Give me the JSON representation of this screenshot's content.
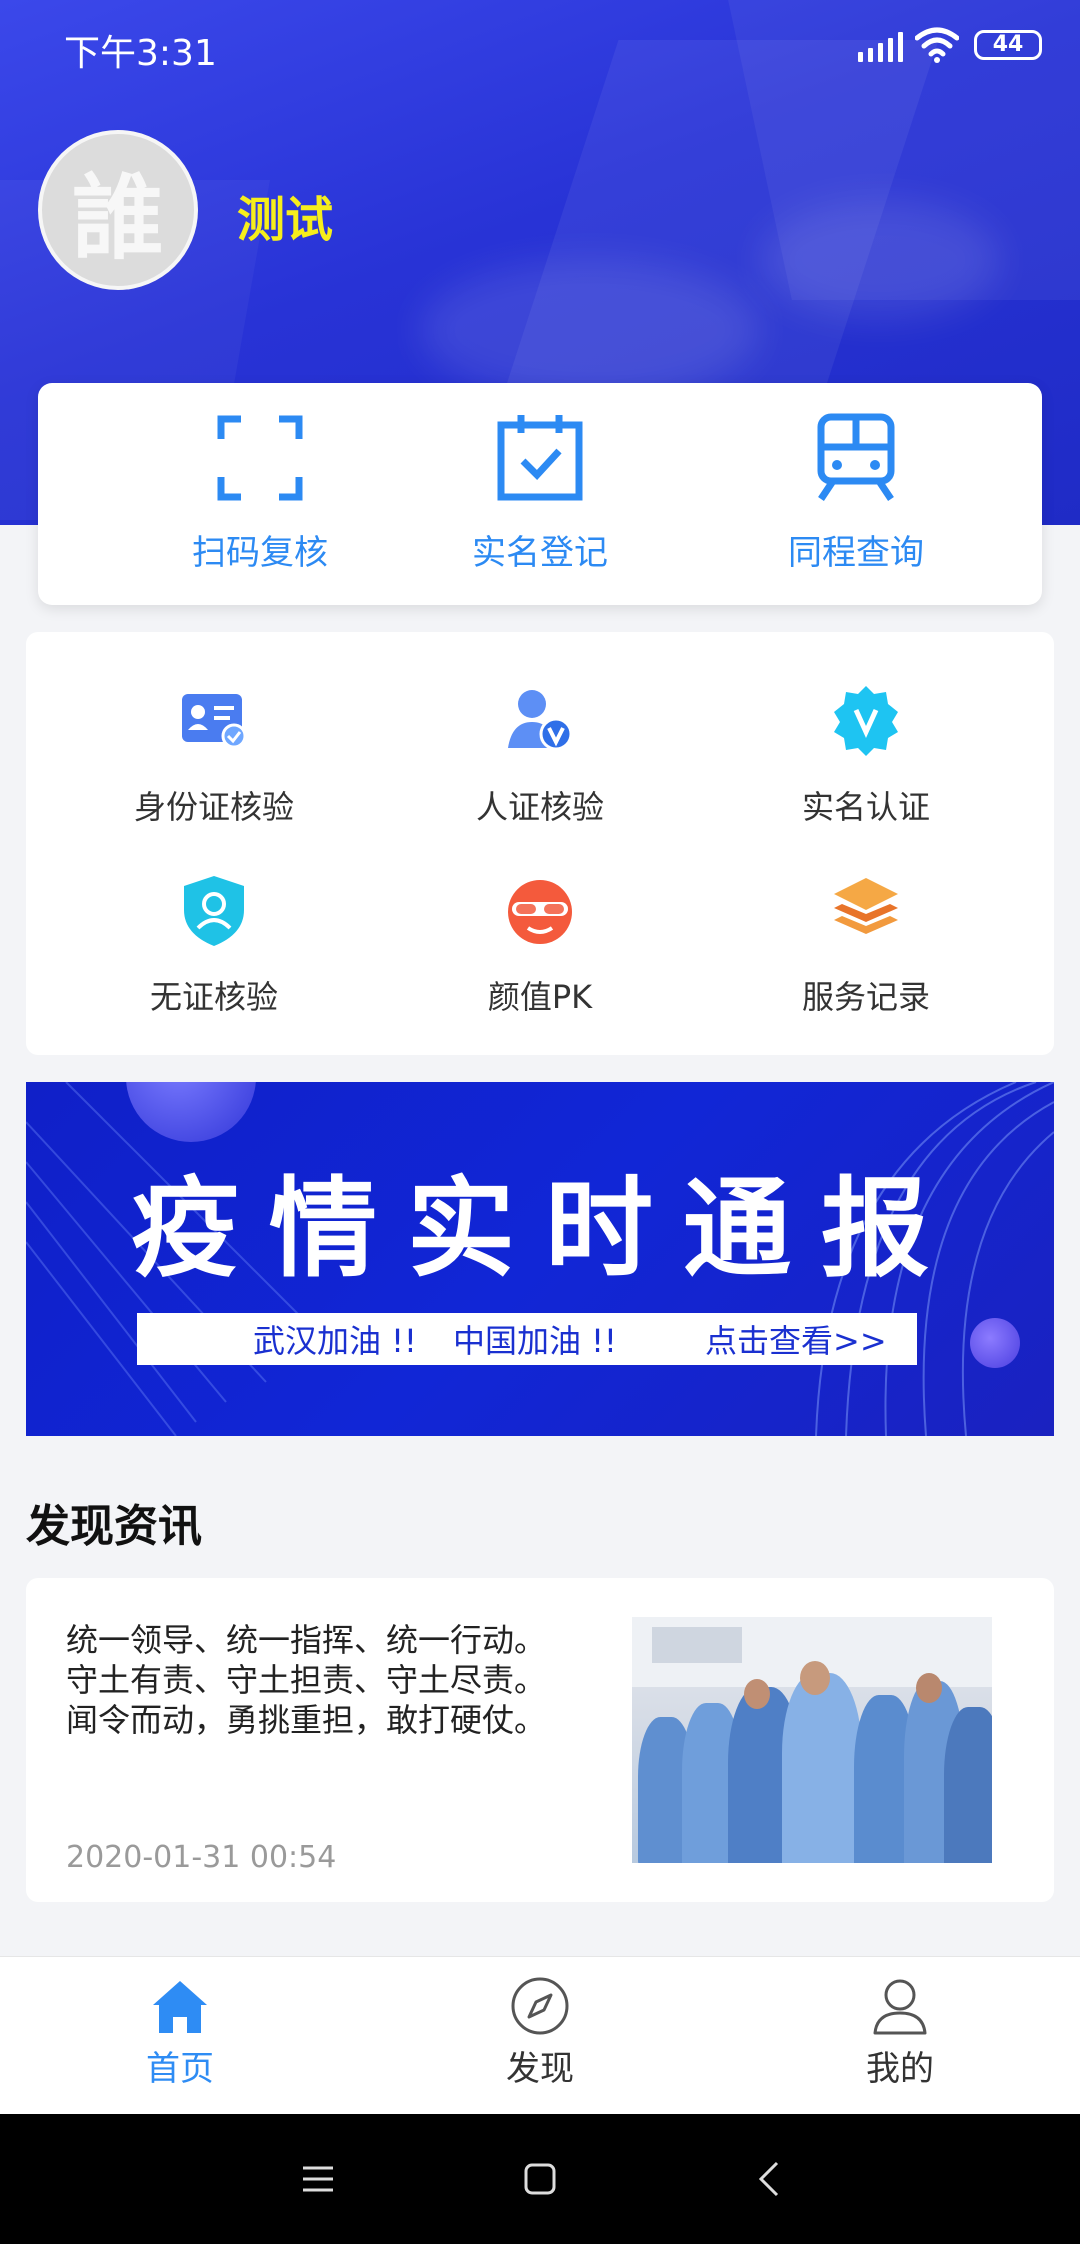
{
  "status_bar": {
    "time": "下午3:31",
    "battery": "44"
  },
  "profile": {
    "avatar_glyph": "誰",
    "username": "测试"
  },
  "quick_actions": [
    {
      "label": "扫码复核",
      "icon": "scan-icon"
    },
    {
      "label": "实名登记",
      "icon": "calendar-check-icon"
    },
    {
      "label": "同程查询",
      "icon": "train-icon"
    }
  ],
  "services": [
    {
      "label": "身份证核验",
      "icon": "id-card-icon"
    },
    {
      "label": "人证核验",
      "icon": "person-verify-icon"
    },
    {
      "label": "实名认证",
      "icon": "verified-badge-icon"
    },
    {
      "label": "无证核验",
      "icon": "shield-person-icon"
    },
    {
      "label": "颜值PK",
      "icon": "face-goggles-icon"
    },
    {
      "label": "服务记录",
      "icon": "layers-icon"
    }
  ],
  "banner": {
    "title": "疫情实时通报",
    "slogan1": "武汉加油 !!",
    "slogan2": "中国加油 !!",
    "link": "点击查看>>"
  },
  "news": {
    "heading": "发现资讯",
    "items": [
      {
        "text": "统一领导、统一指挥、统一行动。\n守土有责、守土担责、守土尽责。\n闻令而动，勇挑重担，敢打硬仗。",
        "date": "2020-01-31 00:54",
        "image": "news-photo"
      }
    ]
  },
  "tabs": [
    {
      "label": "首页",
      "icon": "home-icon",
      "active": true
    },
    {
      "label": "发现",
      "icon": "compass-icon",
      "active": false
    },
    {
      "label": "我的",
      "icon": "user-icon",
      "active": false
    }
  ],
  "colors": {
    "primary": "#2c8af3",
    "header_blue": "#2833d6",
    "username_yellow": "#f6ee1c",
    "banner_blue": "#1126d6"
  }
}
